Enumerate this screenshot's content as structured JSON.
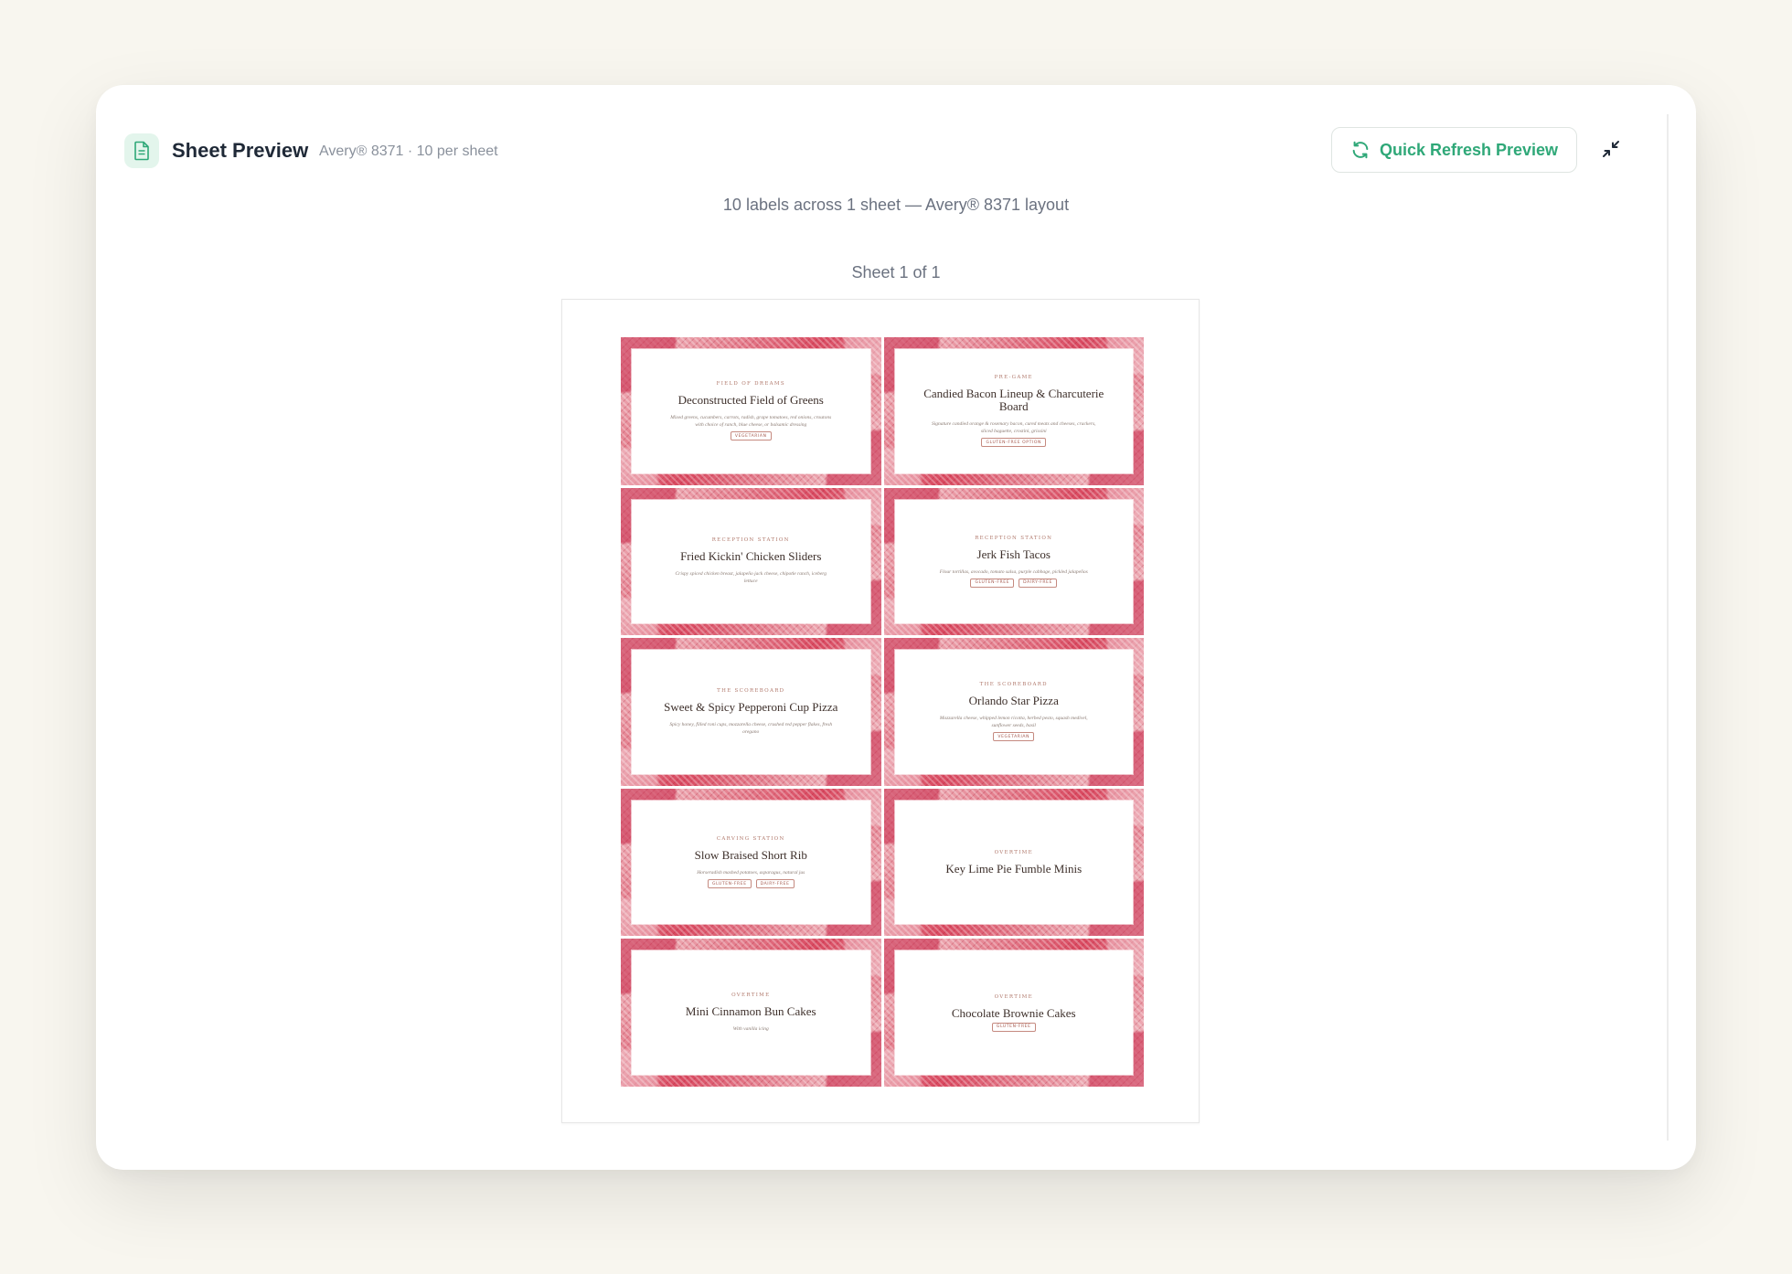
{
  "header": {
    "title": "Sheet Preview",
    "subtitle": "Avery® 8371 · 10 per sheet",
    "icon": "document-icon",
    "refresh_label": "Quick Refresh Preview",
    "refresh_icon": "refresh-icon",
    "collapse_icon": "collapse-icon"
  },
  "summary": "10 labels across 1 sheet — Avery® 8371 layout",
  "sheet_label": "Sheet 1 of 1",
  "colors": {
    "accent": "#2fa878",
    "label_border": "#d9485f",
    "background": "#f8f6ef"
  },
  "labels": [
    {
      "category": "Field of Dreams",
      "name": "Deconstructed Field of Greens",
      "description": "Mixed greens, cucumbers, carrots, radish, grape tomatoes, red onions, croutons with choice of ranch, blue cheese, or balsamic dressing",
      "tags": [
        "Vegetarian"
      ]
    },
    {
      "category": "Pre-Game",
      "name": "Candied Bacon Lineup & Charcuterie Board",
      "description": "Signature candied orange & rosemary bacon, cured meats and cheeses, crackers, sliced baguette, crostini, grissini",
      "tags": [
        "Gluten-Free Option"
      ]
    },
    {
      "category": "Reception Station",
      "name": "Fried Kickin' Chicken Sliders",
      "description": "Crispy spiced chicken breast, jalapeño jack cheese, chipotle ranch, iceberg lettuce",
      "tags": []
    },
    {
      "category": "Reception Station",
      "name": "Jerk Fish Tacos",
      "description": "Flour tortillas, avocado, tomato salsa, purple cabbage, pickled jalapeños",
      "tags": [
        "Gluten-Free",
        "Dairy-Free"
      ]
    },
    {
      "category": "The Scoreboard",
      "name": "Sweet & Spicy Pepperoni Cup Pizza",
      "description": "Spicy honey, filled roni cups, mozzarella cheese, crushed red pepper flakes, fresh oregano",
      "tags": []
    },
    {
      "category": "The Scoreboard",
      "name": "Orlando Star Pizza",
      "description": "Mozzarella cheese, whipped lemon ricotta, herbed pesto, squash medivel, sunflower seeds, basil",
      "tags": [
        "Vegetarian"
      ]
    },
    {
      "category": "Carving Station",
      "name": "Slow Braised Short Rib",
      "description": "Horseradish mashed potatoes, asparagus, natural jus",
      "tags": [
        "Gluten-Free",
        "Dairy-Free"
      ]
    },
    {
      "category": "Overtime",
      "name": "Key Lime Pie Fumble Minis",
      "description": "",
      "tags": []
    },
    {
      "category": "Overtime",
      "name": "Mini Cinnamon Bun Cakes",
      "description": "With vanilla icing",
      "tags": []
    },
    {
      "category": "Overtime",
      "name": "Chocolate Brownie Cakes",
      "description": "",
      "tags": [
        "Gluten-Free"
      ]
    }
  ]
}
